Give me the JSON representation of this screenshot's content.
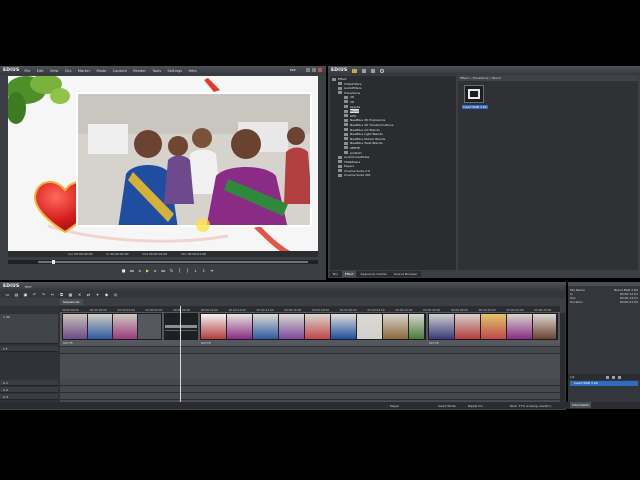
{
  "player": {
    "app_logo": "EDIUS",
    "menu": [
      "File",
      "Edit",
      "View",
      "Clip",
      "Marker",
      "Mode",
      "Capture",
      "Render",
      "Tools",
      "Settings",
      "Help"
    ],
    "mode_label": "PLR",
    "timecodes": {
      "cur": "Cur 00:00:00:00",
      "in": "In 00:00:00:00",
      "out": "Out 00:00:01:00",
      "dur": "Dur 00:00:01:00"
    }
  },
  "effects": {
    "app_logo": "EDIUS",
    "tree": [
      {
        "label": "Effect",
        "indent": 0
      },
      {
        "label": "VideoFilters",
        "indent": 1
      },
      {
        "label": "AudioFilters",
        "indent": 1
      },
      {
        "label": "Transitions",
        "indent": 1
      },
      {
        "label": "2D",
        "indent": 2
      },
      {
        "label": "3D",
        "indent": 2
      },
      {
        "label": "Sparks",
        "indent": 2
      },
      {
        "label": "Blend",
        "indent": 2
      },
      {
        "label": "GPU",
        "indent": 2
      },
      {
        "label": "NewBlue 3D Explosions",
        "indent": 2
      },
      {
        "label": "NewBlue 3D Transformations",
        "indent": 2
      },
      {
        "label": "NewBlue Art Blends",
        "indent": 2
      },
      {
        "label": "NewBlue Light Blends",
        "indent": 2
      },
      {
        "label": "NewBlue Motion Blends",
        "indent": 2
      },
      {
        "label": "NewBlue Twist Blends",
        "indent": 2
      },
      {
        "label": "SMPTE",
        "indent": 2
      },
      {
        "label": "proDAD",
        "indent": 2
      },
      {
        "label": "AudioCrossFades",
        "indent": 1
      },
      {
        "label": "TitleMixers",
        "indent": 1
      },
      {
        "label": "Keyers",
        "indent": 1
      },
      {
        "label": "Cinema Suite 2.0",
        "indent": 1
      },
      {
        "label": "Cinema Suite 301",
        "indent": 1
      }
    ],
    "palette_title": "Effect » Transitions » Blend",
    "selected_effect": "Insert BGB 4 RS",
    "tabs": [
      "Bin",
      "Effect",
      "Sequence marker",
      "Source Browser"
    ],
    "active_tab": "Effect"
  },
  "timeline": {
    "app_logo": "EDIUS",
    "project_name": "TEST",
    "sequence_tab": "Sequence1",
    "ruler": [
      "00:00:00:00",
      "00:00:02:00",
      "00:00:04:00",
      "00:00:06:00",
      "00:00:08:00",
      "00:00:10:00",
      "00:00:12:00",
      "00:00:14:00",
      "00:00:16:00",
      "00:00:18:00",
      "00:00:20:00",
      "00:00:22:00",
      "00:00:24:00",
      "00:00:26:00",
      "00:00:28:00",
      "00:00:30:00",
      "00:00:32:00",
      "00:00:34:00"
    ],
    "tracks": [
      {
        "label": "1 VA",
        "type": "video"
      },
      {
        "label": "1 T",
        "type": "title"
      },
      {
        "label": "A 1",
        "type": "audio"
      },
      {
        "label": "A 2",
        "type": "audio"
      },
      {
        "label": "A 3",
        "type": "audio"
      }
    ],
    "clip_names": [
      "00778",
      "00778",
      "00778"
    ],
    "status": {
      "player_status": "Player",
      "insert_mode": "Insert Mode",
      "ripple": "Ripple On",
      "disk": "Disk: 77% is being used(C:)"
    }
  },
  "info_panel": {
    "rows": [
      {
        "key": "File Name",
        "value": "Blend BGB 4 RS"
      },
      {
        "key": "In",
        "value": "00:00:12:01"
      },
      {
        "key": "Out",
        "value": "00:00:13:01"
      },
      {
        "key": "Duration",
        "value": "00:00:01:00"
      }
    ],
    "layer_title": "1/1",
    "layer_item": "Insert BGB 4 RS",
    "tab": "Information"
  }
}
